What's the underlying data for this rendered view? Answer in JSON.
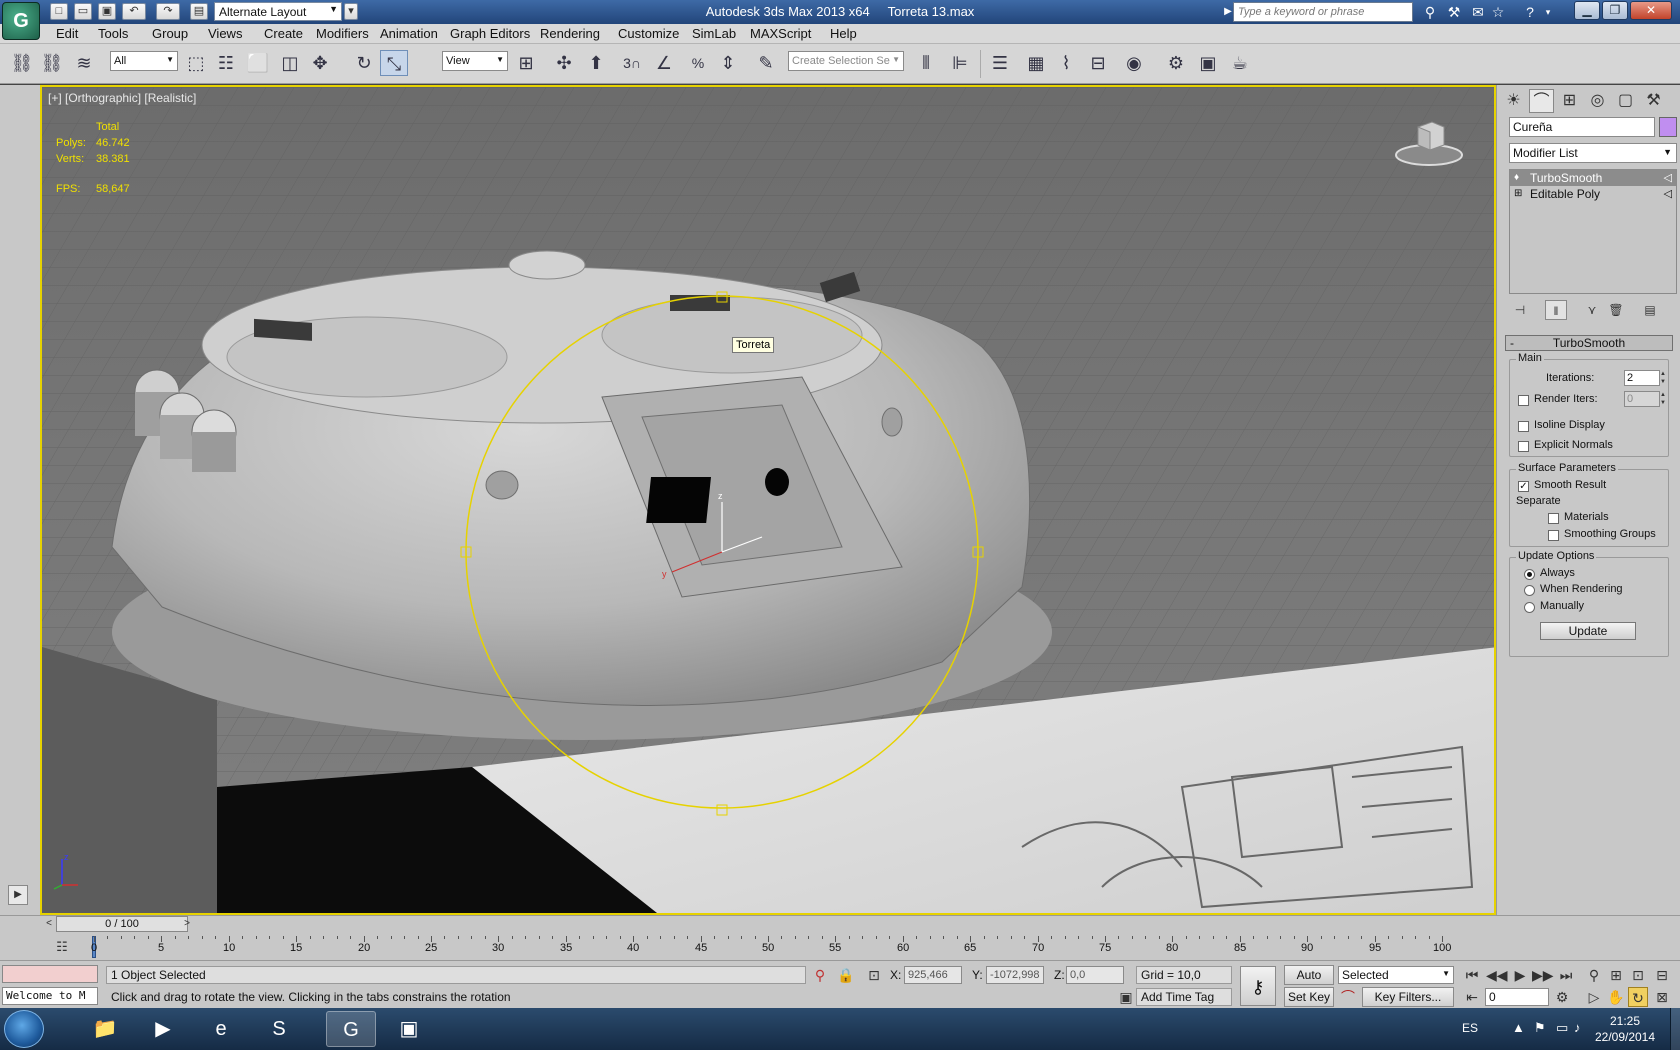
{
  "titlebar": {
    "workspace": "Alternate Layout",
    "app_title": "Autodesk 3ds Max  2013 x64",
    "file_name": "Torreta 13.max",
    "search_placeholder": "Type a keyword or phrase"
  },
  "menu": [
    "Edit",
    "Tools",
    "Group",
    "Views",
    "Create",
    "Modifiers",
    "Animation",
    "Graph Editors",
    "Rendering",
    "Customize",
    "SimLab",
    "MAXScript",
    "Help"
  ],
  "toolbar": {
    "selection_filter": "All",
    "reference_coord": "View",
    "named_selection_placeholder": "Create Selection Se",
    "snap_number": "3"
  },
  "viewport": {
    "label": "[+] [Orthographic] [Realistic]",
    "stats": {
      "total_label": "Total",
      "polys_label": "Polys:",
      "polys": "46.742",
      "verts_label": "Verts:",
      "verts": "38.381",
      "fps_label": "FPS:",
      "fps": "58,647"
    },
    "tooltip": "Torreta",
    "axis_z": "z",
    "gizmo_z": "z",
    "gizmo_y": "y"
  },
  "command_panel": {
    "object_name": "Cureña",
    "object_color": "#c08ef0",
    "modifier_list": "Modifier List",
    "stack": [
      {
        "name": "TurboSmooth",
        "selected": true
      },
      {
        "name": "Editable Poly",
        "selected": false
      }
    ],
    "rollout_title": "TurboSmooth",
    "main_group": "Main",
    "iterations_label": "Iterations:",
    "iterations": "2",
    "render_iters_label": "Render Iters:",
    "render_iters": "0",
    "render_iters_checked": false,
    "isoline_label": "Isoline Display",
    "isoline_checked": false,
    "explicit_normals_label": "Explicit Normals",
    "explicit_normals_checked": false,
    "surface_group": "Surface Parameters",
    "smooth_result_label": "Smooth Result",
    "smooth_result_checked": true,
    "separate_label": "Separate",
    "materials_label": "Materials",
    "materials_checked": false,
    "smoothing_groups_label": "Smoothing Groups",
    "smoothing_groups_checked": false,
    "update_group": "Update Options",
    "update_options": [
      "Always",
      "When Rendering",
      "Manually"
    ],
    "update_selected": "Always",
    "update_button": "Update"
  },
  "timeline": {
    "slider_text": "0 / 100",
    "current_frame": 0,
    "total_frames": 100,
    "tick_labels": [
      "0",
      "5",
      "10",
      "15",
      "20",
      "25",
      "30",
      "35",
      "40",
      "45",
      "50",
      "55",
      "60",
      "65",
      "70",
      "75",
      "80",
      "85",
      "90",
      "95",
      "100"
    ]
  },
  "status": {
    "maxscript_text": "Welcome to M",
    "selection_status": "1 Object Selected",
    "prompt": "Click and drag to rotate the view.  Clicking in the tabs constrains the rotation",
    "x_label": "X:",
    "x": "925,466",
    "y_label": "Y:",
    "y": "-1072,998",
    "z_label": "Z:",
    "z": "0,0",
    "grid": "Grid = 10,0",
    "add_time_tag": "Add Time Tag",
    "auto_key": "Auto Key",
    "set_key": "Set Key",
    "key_mode": "Selected",
    "key_filters": "Key Filters...",
    "frame": "0"
  },
  "taskbar": {
    "language": "ES",
    "time": "21:25",
    "date": "22/09/2014"
  }
}
